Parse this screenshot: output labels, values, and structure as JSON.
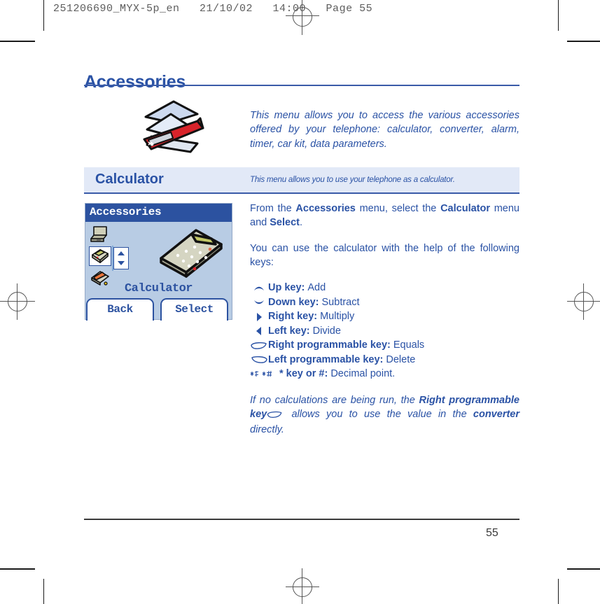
{
  "prepress": {
    "header_line": "251206690_MYX-5p_en   21/10/02   14:00   Page 55",
    "job_number": "251206690_MYX-5p_en",
    "date": "21/10/02",
    "time": "14:00",
    "page_label": "Page 55"
  },
  "page": {
    "title": "Accessories",
    "intro": "This menu allows you to access the various accessories offered by your telephone: calculator, converter, alarm, timer, car kit, data parameters.",
    "folio": "55"
  },
  "section": {
    "heading": "Calculator",
    "subheading": "This menu allows you to use your telephone as a calculator."
  },
  "phone_screen": {
    "title": "Accessories",
    "selected_label": "Calculator",
    "softkey_left": "Back",
    "softkey_right": "Select",
    "icons": [
      {
        "name": "converter-icon",
        "label": "Converter"
      },
      {
        "name": "calculator-icon",
        "label": "Calculator"
      },
      {
        "name": "alarm-icon",
        "label": "Alarm"
      }
    ]
  },
  "body": {
    "para_1_a": "From the ",
    "para_1_b": "Accessories",
    "para_1_c": " menu, select the ",
    "para_1_d": "Calculator",
    "para_1_e": " menu and ",
    "para_1_f": "Select",
    "para_1_g": ".",
    "para_2": "You can use the calculator with the help of the following keys:",
    "keys": [
      {
        "icon": "up-arrow-icon",
        "label": "Up key:",
        "action": "Add"
      },
      {
        "icon": "down-arrow-icon",
        "label": "Down key:",
        "action": "Subtract"
      },
      {
        "icon": "right-arrow-icon",
        "label": "Right key:",
        "action": "Multiply"
      },
      {
        "icon": "left-arrow-icon",
        "label": "Left key:",
        "action": "Divide"
      },
      {
        "icon": "right-soft-key-icon",
        "label": "Right programmable key:",
        "action": "Equals"
      },
      {
        "icon": "left-soft-key-icon",
        "label": "Left programmable key:",
        "action": "Delete"
      },
      {
        "icon": "star-hash-key-icon",
        "label": "* key or #:",
        "action": "Decimal point."
      }
    ],
    "para_3_a": "If no calculations are being run, the ",
    "para_3_b": "Right programmable key",
    "para_3_c": " allows you to use the value in the ",
    "para_3_d": "converter",
    "para_3_e": " directly."
  },
  "colors": {
    "brand_blue": "#2a52a5",
    "band_background": "#e2e9f7",
    "screen_background": "#b8cce4",
    "screen_titlebar": "#2c52a0",
    "rule_dark": "#3a3a3a"
  }
}
